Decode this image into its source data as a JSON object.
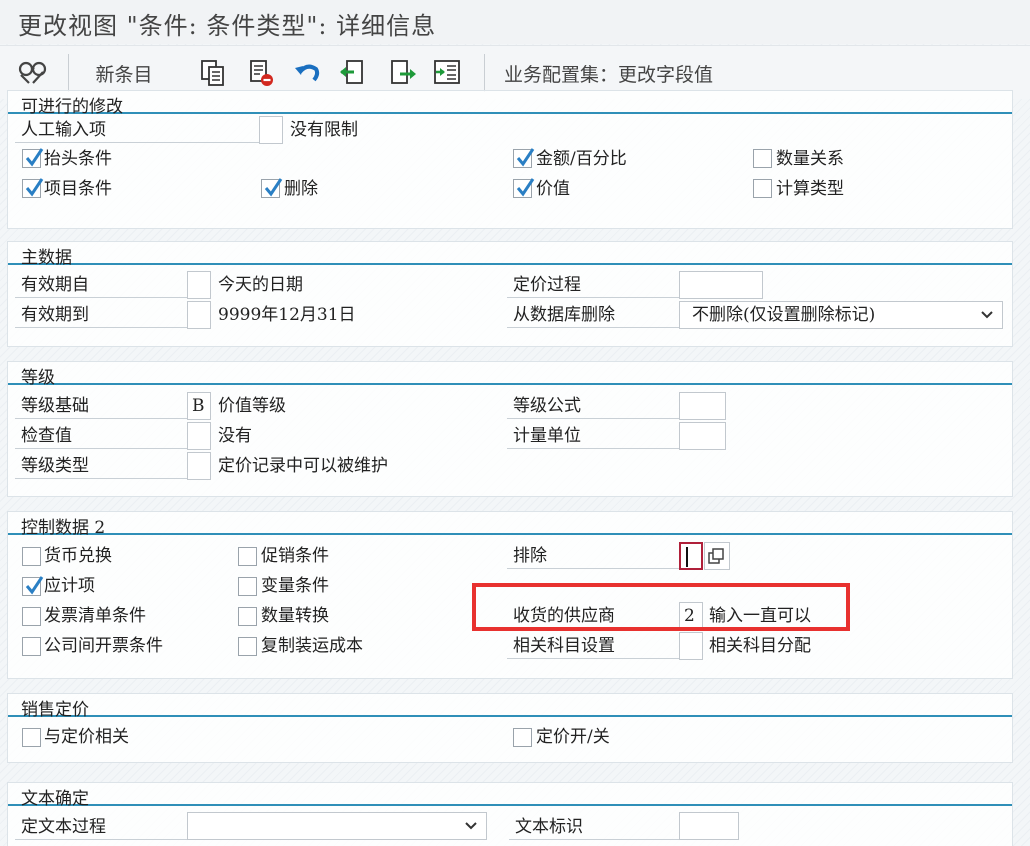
{
  "window": {
    "title": "更改视图 \"条件: 条件类型\": 详细信息"
  },
  "toolbar": {
    "new_entries": "新条目",
    "config_set": "业务配置集：更改字段值",
    "icons": [
      "glasses-icon",
      "copy-icon",
      "delete-icon",
      "undo-icon",
      "previous-entry-icon",
      "next-entry-icon",
      "select-block-icon"
    ]
  },
  "modifications": {
    "header": "可进行的修改",
    "manual_entry_label": "人工输入项",
    "manual_entry_value": "",
    "manual_entry_desc": "没有限制",
    "header_condition": "抬头条件",
    "header_condition_checked": true,
    "item_condition": "项目条件",
    "item_condition_checked": true,
    "delete": "删除",
    "delete_checked": true,
    "amount_pct": "金额/百分比",
    "amount_pct_checked": true,
    "value": "价值",
    "value_checked": true,
    "qty_relation": "数量关系",
    "qty_relation_checked": false,
    "calc_type": "计算类型",
    "calc_type_checked": false
  },
  "master_data": {
    "header": "主数据",
    "valid_from_label": "有效期自",
    "valid_from_value": "",
    "valid_from_desc": "今天的日期",
    "valid_to_label": "有效期到",
    "valid_to_value": "",
    "valid_to_desc": "9999年12月31日",
    "pricing_proc_label": "定价过程",
    "pricing_proc_value": "",
    "delete_db_label": "从数据库删除",
    "delete_db_value": "不删除(仅设置删除标记)"
  },
  "scales": {
    "header": "等级",
    "scale_basis_label": "等级基础",
    "scale_basis_value": "B",
    "scale_basis_desc": "价值等级",
    "check_value_label": "检查值",
    "check_value_value": "",
    "check_value_desc": "没有",
    "scale_type_label": "等级类型",
    "scale_type_value": "",
    "scale_type_desc": "定价记录中可以被维护",
    "scale_formula_label": "等级公式",
    "scale_formula_value": "",
    "uom_label": "计量单位",
    "uom_value": ""
  },
  "control_data": {
    "header": "控制数据 2",
    "currency_conv": "货币兑换",
    "currency_conv_checked": false,
    "accrual": "应计项",
    "accrual_checked": true,
    "invoice_list": "发票清单条件",
    "invoice_list_checked": false,
    "intercompany": "公司间开票条件",
    "intercompany_checked": false,
    "promotion": "促销条件",
    "promotion_checked": false,
    "variant": "变量条件",
    "variant_checked": false,
    "qty_conv": "数量转换",
    "qty_conv_checked": false,
    "copy_shipping": "复制装运成本",
    "copy_shipping_checked": false,
    "exclusion_label": "排除",
    "exclusion_value": "",
    "vendor_label": "收货的供应商",
    "vendor_value": "2",
    "vendor_desc": "输入一直可以",
    "account_label": "相关科目设置",
    "account_value": "",
    "account_desc": "相关科目分配",
    "highlight_color": "#e8312f"
  },
  "sales_pricing": {
    "header": "销售定价",
    "relevant": "与定价相关",
    "relevant_checked": false,
    "switch": "定价开/关",
    "switch_checked": false
  },
  "text_det": {
    "header": "文本确定",
    "proc_label": "定文本过程",
    "proc_value": "",
    "id_label": "文本标识",
    "id_value": ""
  },
  "colors": {
    "accent": "#2f8fb8",
    "check": "#2a7fc4",
    "highlight": "#e8312f"
  }
}
